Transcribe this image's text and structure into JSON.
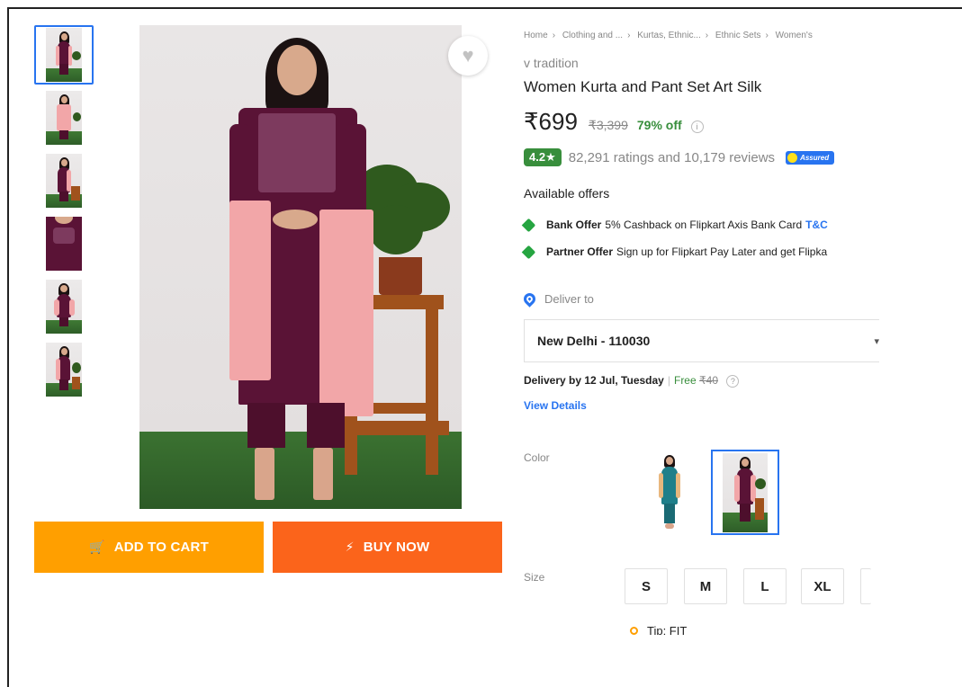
{
  "breadcrumbs": [
    "Home",
    "Clothing and ...",
    "Kurtas, Ethnic...",
    "Ethnic Sets",
    "Women's"
  ],
  "product": {
    "brand": "v tradition",
    "title": "Women Kurta and Pant Set Art Silk",
    "price": "₹699",
    "mrp": "₹3,399",
    "discount": "79% off",
    "rating": "4.2★",
    "ratings_reviews": "82,291 ratings and 10,179 reviews",
    "assured_label": "Assured"
  },
  "actions": {
    "add_to_cart": "ADD TO CART",
    "buy_now": "BUY NOW"
  },
  "offers": {
    "heading": "Available offers",
    "items": [
      {
        "type": "Bank Offer",
        "text": "5% Cashback on Flipkart Axis Bank Card",
        "link": "T&C"
      },
      {
        "type": "Partner Offer",
        "text": "Sign up for Flipkart Pay Later and get Flipka",
        "link": ""
      }
    ]
  },
  "delivery": {
    "heading": "Deliver to",
    "pincode": "New Delhi - 110030",
    "date_text": "Delivery by 12 Jul, Tuesday",
    "free": "Free",
    "fee": "₹40",
    "help": "?",
    "view_details": "View Details"
  },
  "variants": {
    "color_label": "Color",
    "size_label": "Size",
    "sizes": [
      "S",
      "M",
      "L",
      "XL"
    ],
    "selected_color_index": 1
  },
  "fit_tip": "Tip: FIT",
  "colors": {
    "primary": "#2874f0",
    "cart": "#ff9f00",
    "buy": "#fb641b",
    "green": "#388e3c"
  }
}
